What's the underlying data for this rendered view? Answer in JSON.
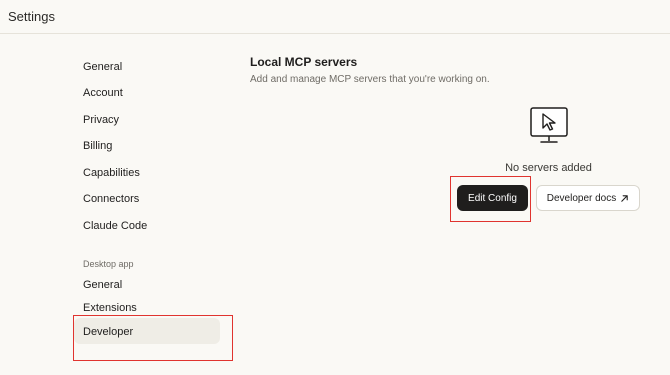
{
  "header": {
    "title": "Settings"
  },
  "sidebar": {
    "items": [
      {
        "label": "General"
      },
      {
        "label": "Account"
      },
      {
        "label": "Privacy"
      },
      {
        "label": "Billing"
      },
      {
        "label": "Capabilities"
      },
      {
        "label": "Connectors"
      },
      {
        "label": "Claude Code"
      }
    ],
    "desktop_section_label": "Desktop app",
    "desktop_items": [
      {
        "label": "General"
      },
      {
        "label": "Extensions"
      },
      {
        "label": "Developer",
        "active": true
      }
    ]
  },
  "main": {
    "title": "Local MCP servers",
    "subtitle": "Add and manage MCP servers that you're working on.",
    "empty_state": {
      "icon": "monitor-cursor-icon",
      "text": "No servers added"
    },
    "buttons": {
      "edit_config": "Edit Config",
      "developer_docs": "Developer docs",
      "developer_docs_icon": "arrow-up-right-icon"
    }
  },
  "colors": {
    "background": "#faf9f5",
    "primary_button": "#1f1e1d",
    "active_item_bg": "#efede6",
    "highlight": "#e0342f"
  }
}
